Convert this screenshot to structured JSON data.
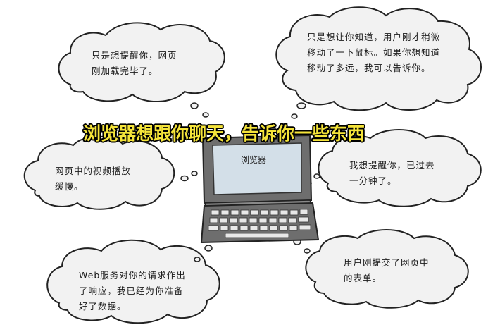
{
  "title": "浏览器想跟你聊天，告诉你一些东西",
  "screen_label": "浏览器",
  "bubbles": {
    "page_loaded": "只是想提醒你，网页\n刚加载完毕了。",
    "mouse_moved": "只是想让你知道，用户刚才稍微\n移动了一下鼠标。如果你想知道\n移动了多远，我可以告诉你。",
    "video_buffering": "网页中的视频播放\n缓慢。",
    "minute_passed": "我想提醒你，已过去\n一分钟了。",
    "server_response": "Web服务对你的请求作出\n了响应，我已经为你准备\n好了数据。",
    "form_submitted": "用户刚提交了网页中\n的表单。"
  },
  "colors": {
    "cloud_fill": "#f2f2f2",
    "title_fill": "#f5e43a",
    "screen": "#d3dfe8",
    "laptop": "#6e6e6e"
  }
}
